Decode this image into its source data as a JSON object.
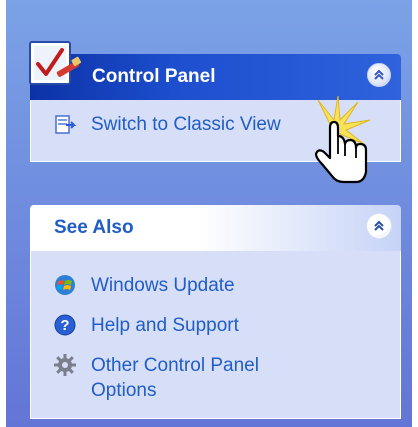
{
  "panels": {
    "control_panel": {
      "title": "Control Panel",
      "icon": "control-panel-icon",
      "items": [
        {
          "label": "Switch to Classic View",
          "icon": "switch-view-icon"
        }
      ]
    },
    "see_also": {
      "title": "See Also",
      "items": [
        {
          "label": "Windows Update",
          "icon": "windows-update-icon"
        },
        {
          "label": "Help and Support",
          "icon": "help-icon"
        },
        {
          "label": "Other Control Panel\nOptions",
          "icon": "gear-icon"
        }
      ]
    }
  },
  "colors": {
    "pane_background": "#6375d6",
    "header_blue": "#0c32a6",
    "link_blue": "#215dc6",
    "body_background": "#d6dff7"
  }
}
